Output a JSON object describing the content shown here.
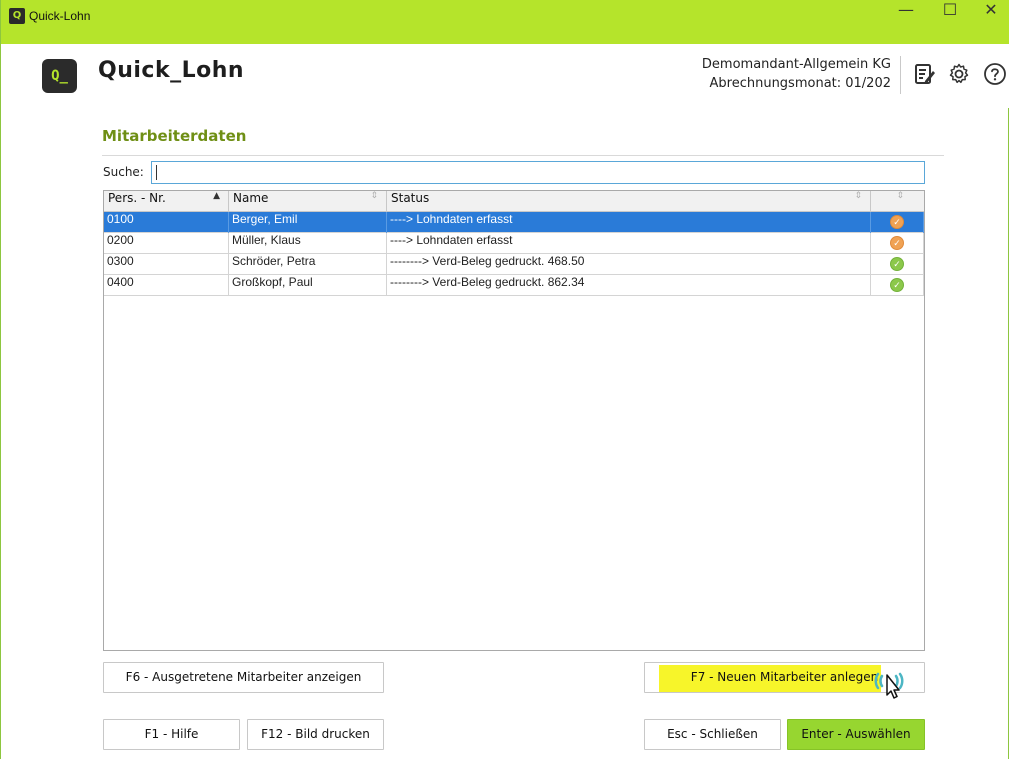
{
  "window": {
    "title": "Quick-Lohn",
    "minimize": "—",
    "maximize": "☐",
    "close": "✕"
  },
  "header": {
    "logo_mark": "Q_",
    "app_name": "Quick_Lohn",
    "company": "Demomandant-Allgemein KG",
    "period": "Abrechnungsmonat: 01/202"
  },
  "section": {
    "title": "Mitarbeiterdaten"
  },
  "search": {
    "label": "Suche:",
    "value": ""
  },
  "table": {
    "columns": [
      "Pers. - Nr.",
      "Name",
      "Status",
      ""
    ],
    "rows": [
      {
        "nr": "0100",
        "name": "Berger, Emil",
        "status": "----> Lohndaten erfasst",
        "state": "orange",
        "selected": true
      },
      {
        "nr": "0200",
        "name": "Müller, Klaus",
        "status": "----> Lohndaten erfasst",
        "state": "orange",
        "selected": false
      },
      {
        "nr": "0300",
        "name": "Schröder, Petra",
        "status": "--------> Verd-Beleg gedruckt. 468.50",
        "state": "green",
        "selected": false
      },
      {
        "nr": "0400",
        "name": "Großkopf, Paul",
        "status": "--------> Verd-Beleg gedruckt. 862.34",
        "state": "green",
        "selected": false
      }
    ]
  },
  "buttons": {
    "f6": "F6 - Ausgetretene Mitarbeiter anzeigen",
    "f7": "F7 - Neuen Mitarbeiter anlegen",
    "f1": "F1 - Hilfe",
    "f12": "F12 - Bild drucken",
    "esc": "Esc - Schließen",
    "enter": "Enter - Auswählen"
  },
  "colors": {
    "titlebar": "#b5e42b",
    "accent_title": "#6f8f15",
    "selection": "#2a7bd8",
    "enter_button": "#97d630",
    "highlight": "#f7f52a"
  }
}
